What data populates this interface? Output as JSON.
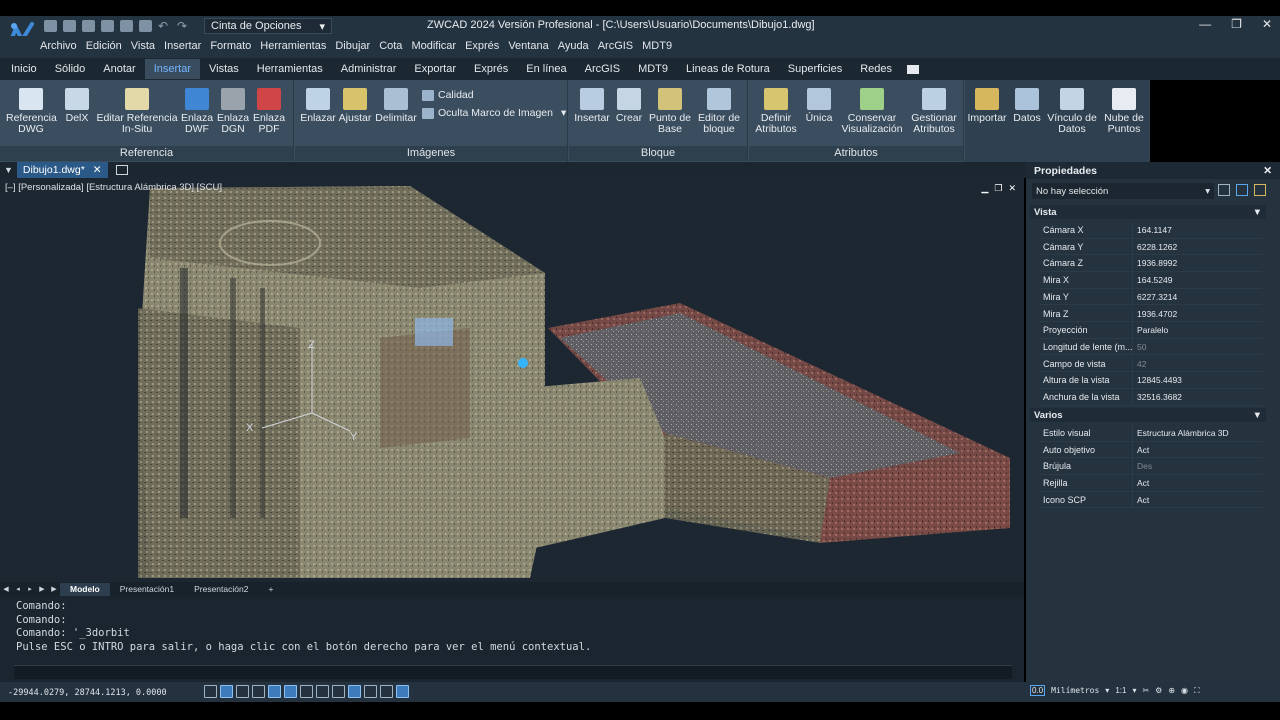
{
  "window": {
    "title": "ZWCAD 2024 Versión Profesional - [C:\\Users\\Usuario\\Documents\\Dibujo1.dwg]",
    "workspace": "Cinta de Opciones",
    "accent": "#74b5ff"
  },
  "menu": [
    "Archivo",
    "Edición",
    "Vista",
    "Insertar",
    "Formato",
    "Herramientas",
    "Dibujar",
    "Cota",
    "Modificar",
    "Exprés",
    "Ventana",
    "Ayuda",
    "ArcGIS",
    "MDT9"
  ],
  "tabs": [
    "Inicio",
    "Sólido",
    "Anotar",
    "Insertar",
    "Vistas",
    "Herramientas",
    "Administrar",
    "Exportar",
    "Exprés",
    "En línea",
    "ArcGIS",
    "MDT9",
    "Lineas de Rotura",
    "Superficies",
    "Redes"
  ],
  "active_tab": "Insertar",
  "ribbon": {
    "referencia": {
      "label": "Referencia",
      "buttons": [
        "Referencia DWG",
        "DelX",
        "Editar Referencia In-Situ",
        "Enlaza DWF",
        "Enlaza DGN",
        "Enlaza PDF"
      ]
    },
    "imagenes": {
      "label": "Imágenes",
      "buttons": [
        "Enlazar",
        "Ajustar",
        "Delimitar"
      ],
      "small": [
        "Calidad",
        "Oculta Marco de Imagen"
      ]
    },
    "bloque": {
      "label": "Bloque",
      "buttons": [
        "Insertar",
        "Crear",
        "Punto de Base",
        "Editor de bloque"
      ]
    },
    "atributos": {
      "label": "Atributos",
      "buttons": [
        "Definir Atributos",
        "Única",
        "Conservar Visualización",
        "Gestionar Atributos"
      ]
    },
    "extra": [
      "Importar",
      "Datos",
      "Vínculo de Datos",
      "Nube de Puntos"
    ]
  },
  "document": {
    "tab": "Dibujo1.dwg*",
    "viewport_label": "[–] [Personalizada] [Estructura Alámbrica 3D] [SCU]"
  },
  "layouts": [
    "Modelo",
    "Presentación1",
    "Presentación2",
    "+"
  ],
  "command_history": [
    "Comando:",
    "Comando:",
    "Comando: '_3dorbit",
    "Pulse ESC o INTRO para salir, o haga clic con el botón derecho para ver el menú contextual."
  ],
  "status": {
    "coords": "-29944.0279, 28744.1213, 0.0000",
    "units": "Milímetros",
    "scale": "1:1"
  },
  "properties": {
    "title": "Propiedades",
    "selection": "No hay selección",
    "vista": {
      "label": "Vista",
      "rows": [
        {
          "k": "Cámara X",
          "v": "164.1147"
        },
        {
          "k": "Cámara Y",
          "v": "6228.1262"
        },
        {
          "k": "Cámara Z",
          "v": "1936.8992"
        },
        {
          "k": "Mira X",
          "v": "164.5249"
        },
        {
          "k": "Mira Y",
          "v": "6227.3214"
        },
        {
          "k": "Mira Z",
          "v": "1936.4702"
        },
        {
          "k": "Proyección",
          "v": "Paralelo"
        },
        {
          "k": "Longitud de lente (m...",
          "v": "50"
        },
        {
          "k": "Campo de vista",
          "v": "42"
        },
        {
          "k": "Altura de la vista",
          "v": "12845.4493"
        },
        {
          "k": "Anchura de la vista",
          "v": "32516.3682"
        }
      ]
    },
    "varios": {
      "label": "Varios",
      "rows": [
        {
          "k": "Estilo visual",
          "v": "Estructura Alámbrica 3D"
        },
        {
          "k": "Auto objetivo",
          "v": "Act"
        },
        {
          "k": "Brújula",
          "v": "Des"
        },
        {
          "k": "Rejilla",
          "v": "Act"
        },
        {
          "k": "Icono SCP",
          "v": "Act"
        }
      ]
    }
  }
}
